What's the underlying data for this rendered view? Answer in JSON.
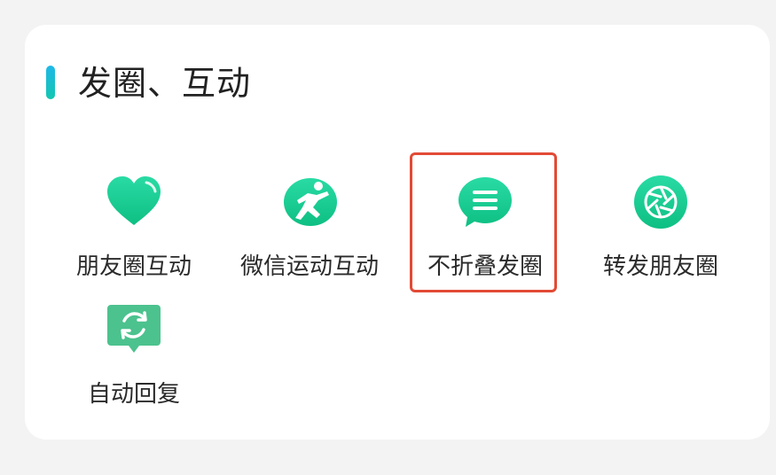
{
  "section": {
    "title": "发圈、互动"
  },
  "items": [
    {
      "label": "朋友圈互动",
      "icon": "heart-icon"
    },
    {
      "label": "微信运动互动",
      "icon": "running-person-icon"
    },
    {
      "label": "不折叠发圈",
      "icon": "message-lines-icon"
    },
    {
      "label": "转发朋友圈",
      "icon": "aperture-icon"
    },
    {
      "label": "自动回复",
      "icon": "refresh-message-icon"
    }
  ],
  "highlight": {
    "target": "不折叠发圈",
    "color": "#e24a35"
  },
  "colors": {
    "accent_top": "#1fb8e8",
    "accent_bottom": "#12c6b0",
    "icon_green": "#10c98c",
    "icon_green_light": "#29dba4",
    "auto_reply_green": "#4cc28e"
  }
}
